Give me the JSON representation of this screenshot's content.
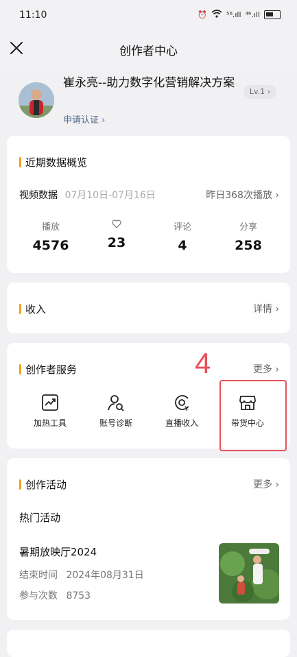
{
  "status_bar": {
    "time": "11:10",
    "signal_left": "⁵⁶.ıll",
    "signal_right": "⁴⁶.ıll"
  },
  "nav": {
    "title": "创作者中心"
  },
  "profile": {
    "name": "崔永亮--助力数字化营销解决方案",
    "apply_label": "申请认证 ›",
    "level": "Lv.1 ›"
  },
  "overview": {
    "title": "近期数据概览",
    "video_label": "视频数据",
    "date_range": "07月10日-07月16日",
    "yesterday_label": "昨日368次播放 ›",
    "metrics": [
      {
        "label": "播放",
        "value": "4576"
      },
      {
        "icon": "heart-icon",
        "value": "23"
      },
      {
        "label": "评论",
        "value": "4"
      },
      {
        "label": "分享",
        "value": "258"
      }
    ]
  },
  "income": {
    "title": "收入",
    "detail_label": "详情 ›"
  },
  "services": {
    "title": "创作者服务",
    "more_label": "更多 ›",
    "step_marker": "4",
    "items": [
      {
        "label": "加热工具",
        "icon": "trend-chart-icon"
      },
      {
        "label": "账号诊断",
        "icon": "user-search-icon"
      },
      {
        "label": "直播收入",
        "icon": "live-income-icon"
      },
      {
        "label": "带货中心",
        "icon": "storefront-icon"
      }
    ]
  },
  "activity": {
    "title": "创作活动",
    "more_label": "更多 ›",
    "subtitle": "热门活动",
    "event_name": "暑期放映厅2024",
    "end_label": "结束时间",
    "end_date": "2024年08月31日",
    "count_label": "参与次数",
    "count_value": "8753"
  },
  "colors": {
    "accent": "#f0a21c",
    "highlight": "#e8505b",
    "link": "#4f6a8f"
  }
}
